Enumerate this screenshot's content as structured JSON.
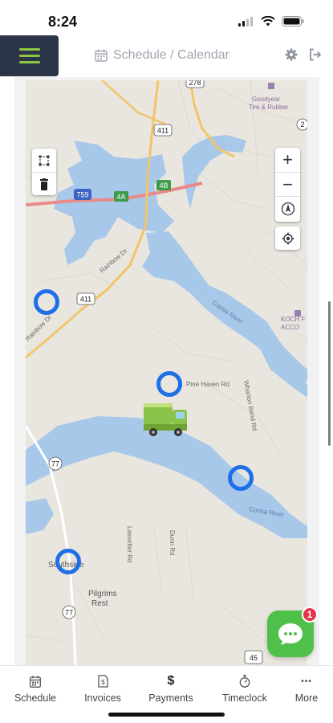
{
  "status_bar": {
    "time": "8:24"
  },
  "header": {
    "title": "Schedule / Calendar",
    "icons": {
      "calendar": "calendar-icon",
      "settings": "gear-icon",
      "logout": "logout-icon",
      "menu": "hamburger-icon"
    }
  },
  "map": {
    "labels": {
      "road_411_a": "411",
      "road_411_b": "411",
      "road_759": "759",
      "exit_4a": "4A",
      "exit_4b": "4B",
      "road_278": "278",
      "road_77_a": "77",
      "road_77_b": "77",
      "road_45": "45",
      "road_2": "2",
      "rainbow_dr_1": "Rainbow Dr",
      "rainbow_dr_2": "Rainbow Dr",
      "pine_haven": "Pine Haven Rd",
      "wharton_bend": "Wharton Bend Rd",
      "coosa_river_1": "Coosa River",
      "coosa_river_2": "Coosa River",
      "goodyear": "Goodyear\nTire & Rubber",
      "koch": "KOCH F\nACCO",
      "southside": "Southside",
      "pilgrims_rest": "Pilgrims\nRest",
      "lassetter_rd": "Lassetter Rd",
      "dunn_rd": "Dunn Rd"
    },
    "controls": {
      "zoom_in": "+",
      "zoom_out": "−"
    },
    "marker_color": "#1f6fe8",
    "water_color": "#a8c8ea"
  },
  "chat": {
    "badge_count": "1"
  },
  "tabs": [
    {
      "label": "Schedule",
      "icon": "calendar-icon"
    },
    {
      "label": "Invoices",
      "icon": "invoice-icon"
    },
    {
      "label": "Payments",
      "icon": "dollar-icon",
      "symbol": "$"
    },
    {
      "label": "Timeclock",
      "icon": "stopwatch-icon"
    },
    {
      "label": "More",
      "icon": "more-icon",
      "symbol": "•••"
    }
  ]
}
